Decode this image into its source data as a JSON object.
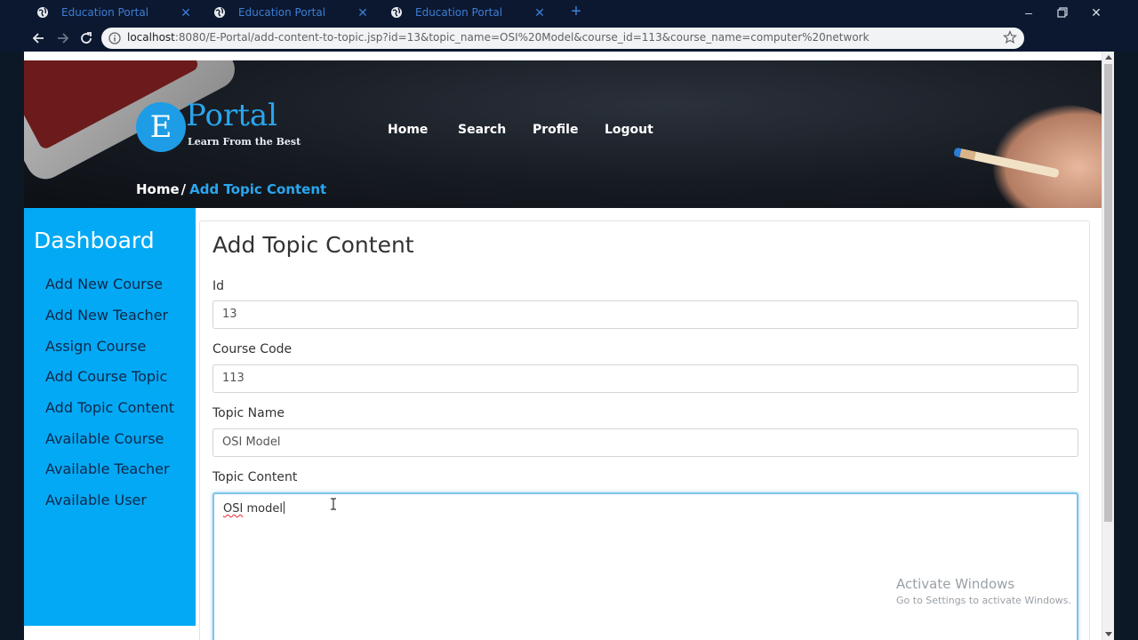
{
  "browser": {
    "tabs": [
      {
        "title": "Education Portal"
      },
      {
        "title": "Education Portal"
      },
      {
        "title": "Education Portal"
      }
    ],
    "address": {
      "host": "localhost",
      "rest": ":8080/E-Portal/add-content-to-topic.jsp?id=13&topic_name=OSI%20Model&course_id=113&course_name=computer%20network"
    },
    "icons": {
      "back": "arrow-left-icon",
      "forward": "arrow-right-icon",
      "reload": "reload-icon",
      "info": "info-icon",
      "bookmark": "star-icon",
      "extension": "pdf-icon",
      "profile": "avatar",
      "menu": "kebab-menu-icon",
      "new_tab": "plus-icon",
      "minimize": "minimize-icon",
      "restore": "restore-icon",
      "close_window": "close-icon"
    }
  },
  "header": {
    "logo": {
      "letter": "E",
      "word": "Portal",
      "tagline": "Learn From the Best"
    },
    "nav": [
      "Home",
      "Search",
      "Profile",
      "Logout"
    ],
    "breadcrumb": {
      "home": "Home",
      "separator": "/",
      "current": "Add Topic Content"
    }
  },
  "sidebar": {
    "heading": "Dashboard",
    "items": [
      "Add New Course",
      "Add New Teacher",
      "Assign Course",
      "Add Course Topic",
      "Add Topic Content",
      "Available Course",
      "Available Teacher",
      "Available User"
    ]
  },
  "form": {
    "title": "Add Topic Content",
    "id": {
      "label": "Id",
      "value": "13"
    },
    "course_code": {
      "label": "Course Code",
      "value": "113"
    },
    "topic_name": {
      "label": "Topic Name",
      "value": "OSI Model"
    },
    "topic_content": {
      "label": "Topic Content",
      "value_misspelled": "OSI",
      "value_rest": " model"
    }
  },
  "watermark": {
    "line1": "Activate Windows",
    "line2": "Go to Settings to activate Windows."
  },
  "colors": {
    "accent": "#2aa6ef",
    "sidebar": "#03a9f4",
    "sidebar_text": "#10284a",
    "tab_text": "#3d7fd6"
  }
}
